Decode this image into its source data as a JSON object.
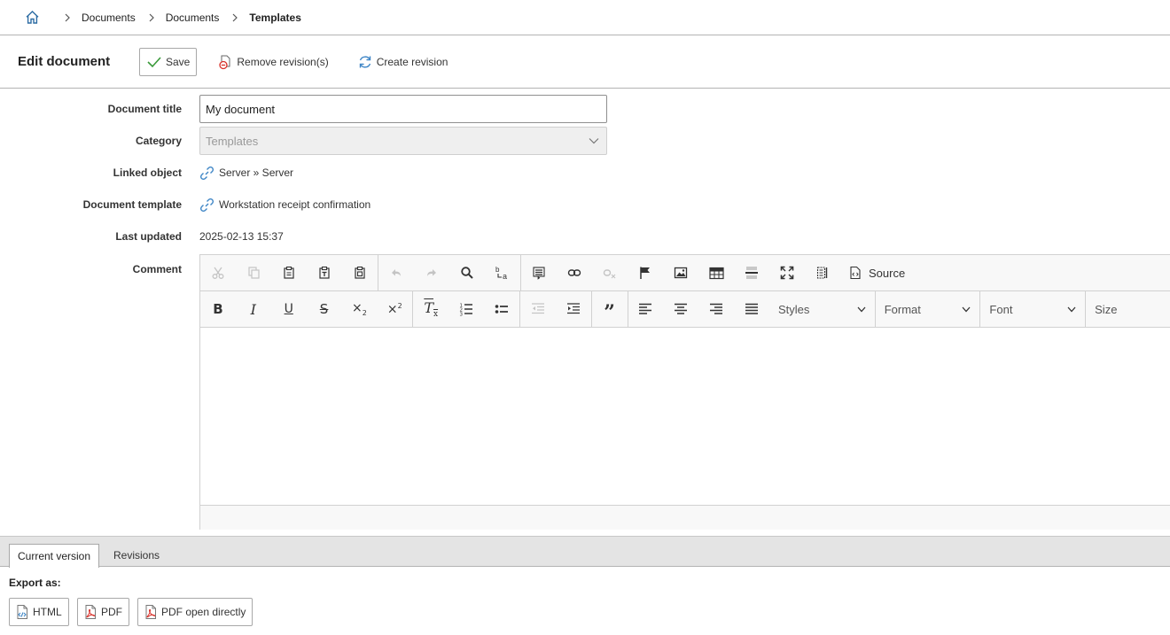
{
  "breadcrumb": {
    "items": [
      {
        "label": "Documents"
      },
      {
        "label": "Documents"
      },
      {
        "label": "Templates"
      }
    ]
  },
  "toolbar": {
    "title": "Edit document",
    "save_label": "Save",
    "remove_label": "Remove revision(s)",
    "create_label": "Create revision"
  },
  "form": {
    "title": {
      "label": "Document title",
      "value": "My document"
    },
    "category": {
      "label": "Category",
      "value": "Templates"
    },
    "linked_object": {
      "label": "Linked object",
      "value": "Server » Server"
    },
    "template": {
      "label": "Document template",
      "value": "Workstation receipt confirmation"
    },
    "last_updated": {
      "label": "Last updated",
      "value": "2025-02-13 15:37"
    },
    "comment": {
      "label": "Comment"
    }
  },
  "editor": {
    "source_label": "Source",
    "styles_label": "Styles",
    "format_label": "Format",
    "font_label": "Font",
    "size_label": "Size"
  },
  "tabs": [
    {
      "label": "Current version",
      "active": true
    },
    {
      "label": "Revisions",
      "active": false
    }
  ],
  "export": {
    "label": "Export as:",
    "html_label": "HTML",
    "pdf_label": "PDF",
    "pdf_direct_label": "PDF open directly"
  },
  "colors": {
    "accent_blue": "#3f86c6",
    "pdf_red": "#d9312a",
    "save_green": "#3a9a3a"
  }
}
